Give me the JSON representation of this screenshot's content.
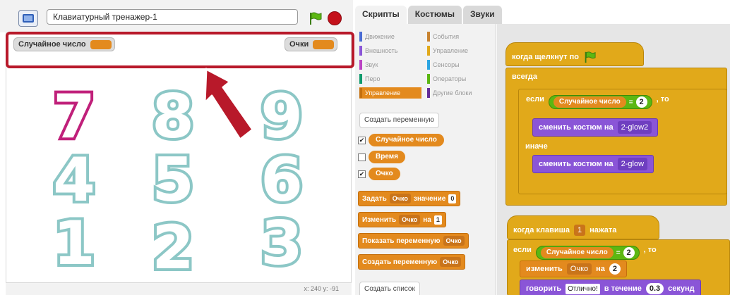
{
  "project_title": "Клавиатурный тренажер-1",
  "monitors": {
    "random_label": "Случайное число",
    "score_label": "Очки"
  },
  "stage_digits": [
    "7",
    "8",
    "9",
    "4",
    "5",
    "6",
    "1",
    "2",
    "3"
  ],
  "stage_footer": "x: 240 y: -91",
  "tabs": [
    "Скрипты",
    "Костюмы",
    "Звуки"
  ],
  "categories": [
    {
      "label": "Движение",
      "color": "#4a6cd4"
    },
    {
      "label": "События",
      "color": "#c88330"
    },
    {
      "label": "Внешность",
      "color": "#8a55d7"
    },
    {
      "label": "Управление",
      "color": "#e1a91a"
    },
    {
      "label": "Звук",
      "color": "#bb42c3"
    },
    {
      "label": "Сенсоры",
      "color": "#2ca5e2"
    },
    {
      "label": "Перо",
      "color": "#0e9a6c"
    },
    {
      "label": "Операторы",
      "color": "#5cb712"
    },
    {
      "label": "Управление",
      "color": "#e38a1e"
    },
    {
      "label": "Другие блоки",
      "color": "#632d99"
    }
  ],
  "palette": {
    "create_variable": "Создать переменную",
    "variables": [
      {
        "label": "Случайное число",
        "checked": "✔"
      },
      {
        "label": "Время",
        "checked": ""
      },
      {
        "label": "Очко",
        "checked": "✔"
      }
    ],
    "set_block": {
      "verb": "Задать",
      "var": "Очко",
      "word": "значение",
      "value": "0"
    },
    "change_block": {
      "verb": "Изменить",
      "var": "Очко",
      "word": "на",
      "value": "1"
    },
    "show_block": {
      "text": "Показать переменную",
      "var": "Очко"
    },
    "hide_block": {
      "text": "Создать переменную",
      "var": "Очко"
    },
    "create_list": "Создать список"
  },
  "script1": {
    "hat": "когда щелкнут по",
    "forever": "всегда",
    "if": "если",
    "var": "Случайное число",
    "op": "=",
    "value": "2",
    "then": ", то",
    "switch1": "сменить костюм на",
    "costume1": "2-glow2",
    "else": "иначе",
    "switch2": "сменить костюм на",
    "costume2": "2-glow"
  },
  "script2": {
    "hat": "когда клавиша",
    "key": "1",
    "pressed": "нажата",
    "if": "если",
    "var": "Случайное число",
    "op": "=",
    "value": "2",
    "then": ", то",
    "change": "изменить",
    "change_var": "Очко",
    "on": "на",
    "change_val": "2",
    "say": "говорить",
    "say_text": "Отлично!",
    "during": "в течение",
    "secs": "0.3",
    "seconds": "секунд"
  }
}
